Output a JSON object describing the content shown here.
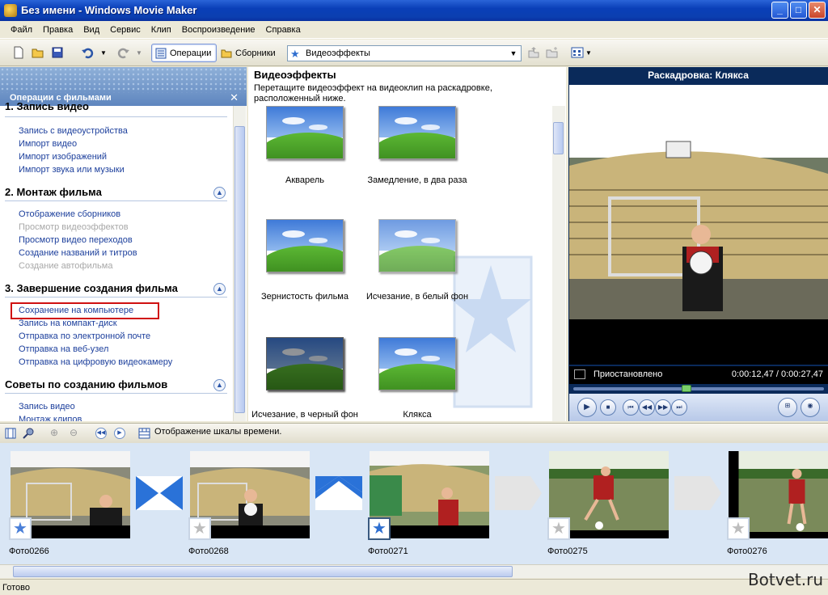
{
  "window": {
    "title": "Без имени - Windows Movie Maker"
  },
  "menu": [
    "Файл",
    "Правка",
    "Вид",
    "Сервис",
    "Клип",
    "Воспроизведение",
    "Справка"
  ],
  "toolbar": {
    "operations_label": "Операции",
    "collections_label": "Сборники",
    "collection_select": "Видеоэффекты"
  },
  "tasks": {
    "panel_title": "Операции с фильмами",
    "sections": [
      {
        "title": "1. Запись видео",
        "items": [
          "Запись с видеоустройства",
          "Импорт видео",
          "Импорт изображений",
          "Импорт звука или музыки"
        ]
      },
      {
        "title": "2. Монтаж фильма",
        "items": [
          "Отображение сборников",
          "Просмотр видеоэффектов",
          "Просмотр видео переходов",
          "Создание названий и титров",
          "Создание автофильма"
        ]
      },
      {
        "title": "3. Завершение создания фильма",
        "items": [
          "Сохранение на компьютере",
          "Запись на компакт-диск",
          "Отправка по электронной почте",
          "Отправка на веб-узел",
          "Отправка на цифровую видеокамеру"
        ]
      },
      {
        "title": "Советы по созданию фильмов",
        "items": [
          "Запись видео",
          "Монтаж клипов"
        ]
      }
    ]
  },
  "content": {
    "title": "Видеоэффекты",
    "description": "Перетащите видеоэффект на видеоклип на раскадровке, расположенный ниже.",
    "effects": [
      "Акварель",
      "Замедление, в два раза",
      "Зернистость фильма",
      "Исчезание, в белый фон",
      "Исчезание, в черный фон",
      "Клякса"
    ]
  },
  "preview": {
    "title": "Раскадровка: Клякса",
    "status": "Приостановлено",
    "time": "0:00:12,47 / 0:00:27,47",
    "progress": 0.45
  },
  "timeline_bar": {
    "label": "Отображение шкалы времени."
  },
  "storyboard": {
    "clips": [
      "Фото0266",
      "Фото0268",
      "Фото0271",
      "Фото0275",
      "Фото0276"
    ]
  },
  "statusbar": {
    "text": "Готово",
    "watermark": "Botvet.ru"
  }
}
